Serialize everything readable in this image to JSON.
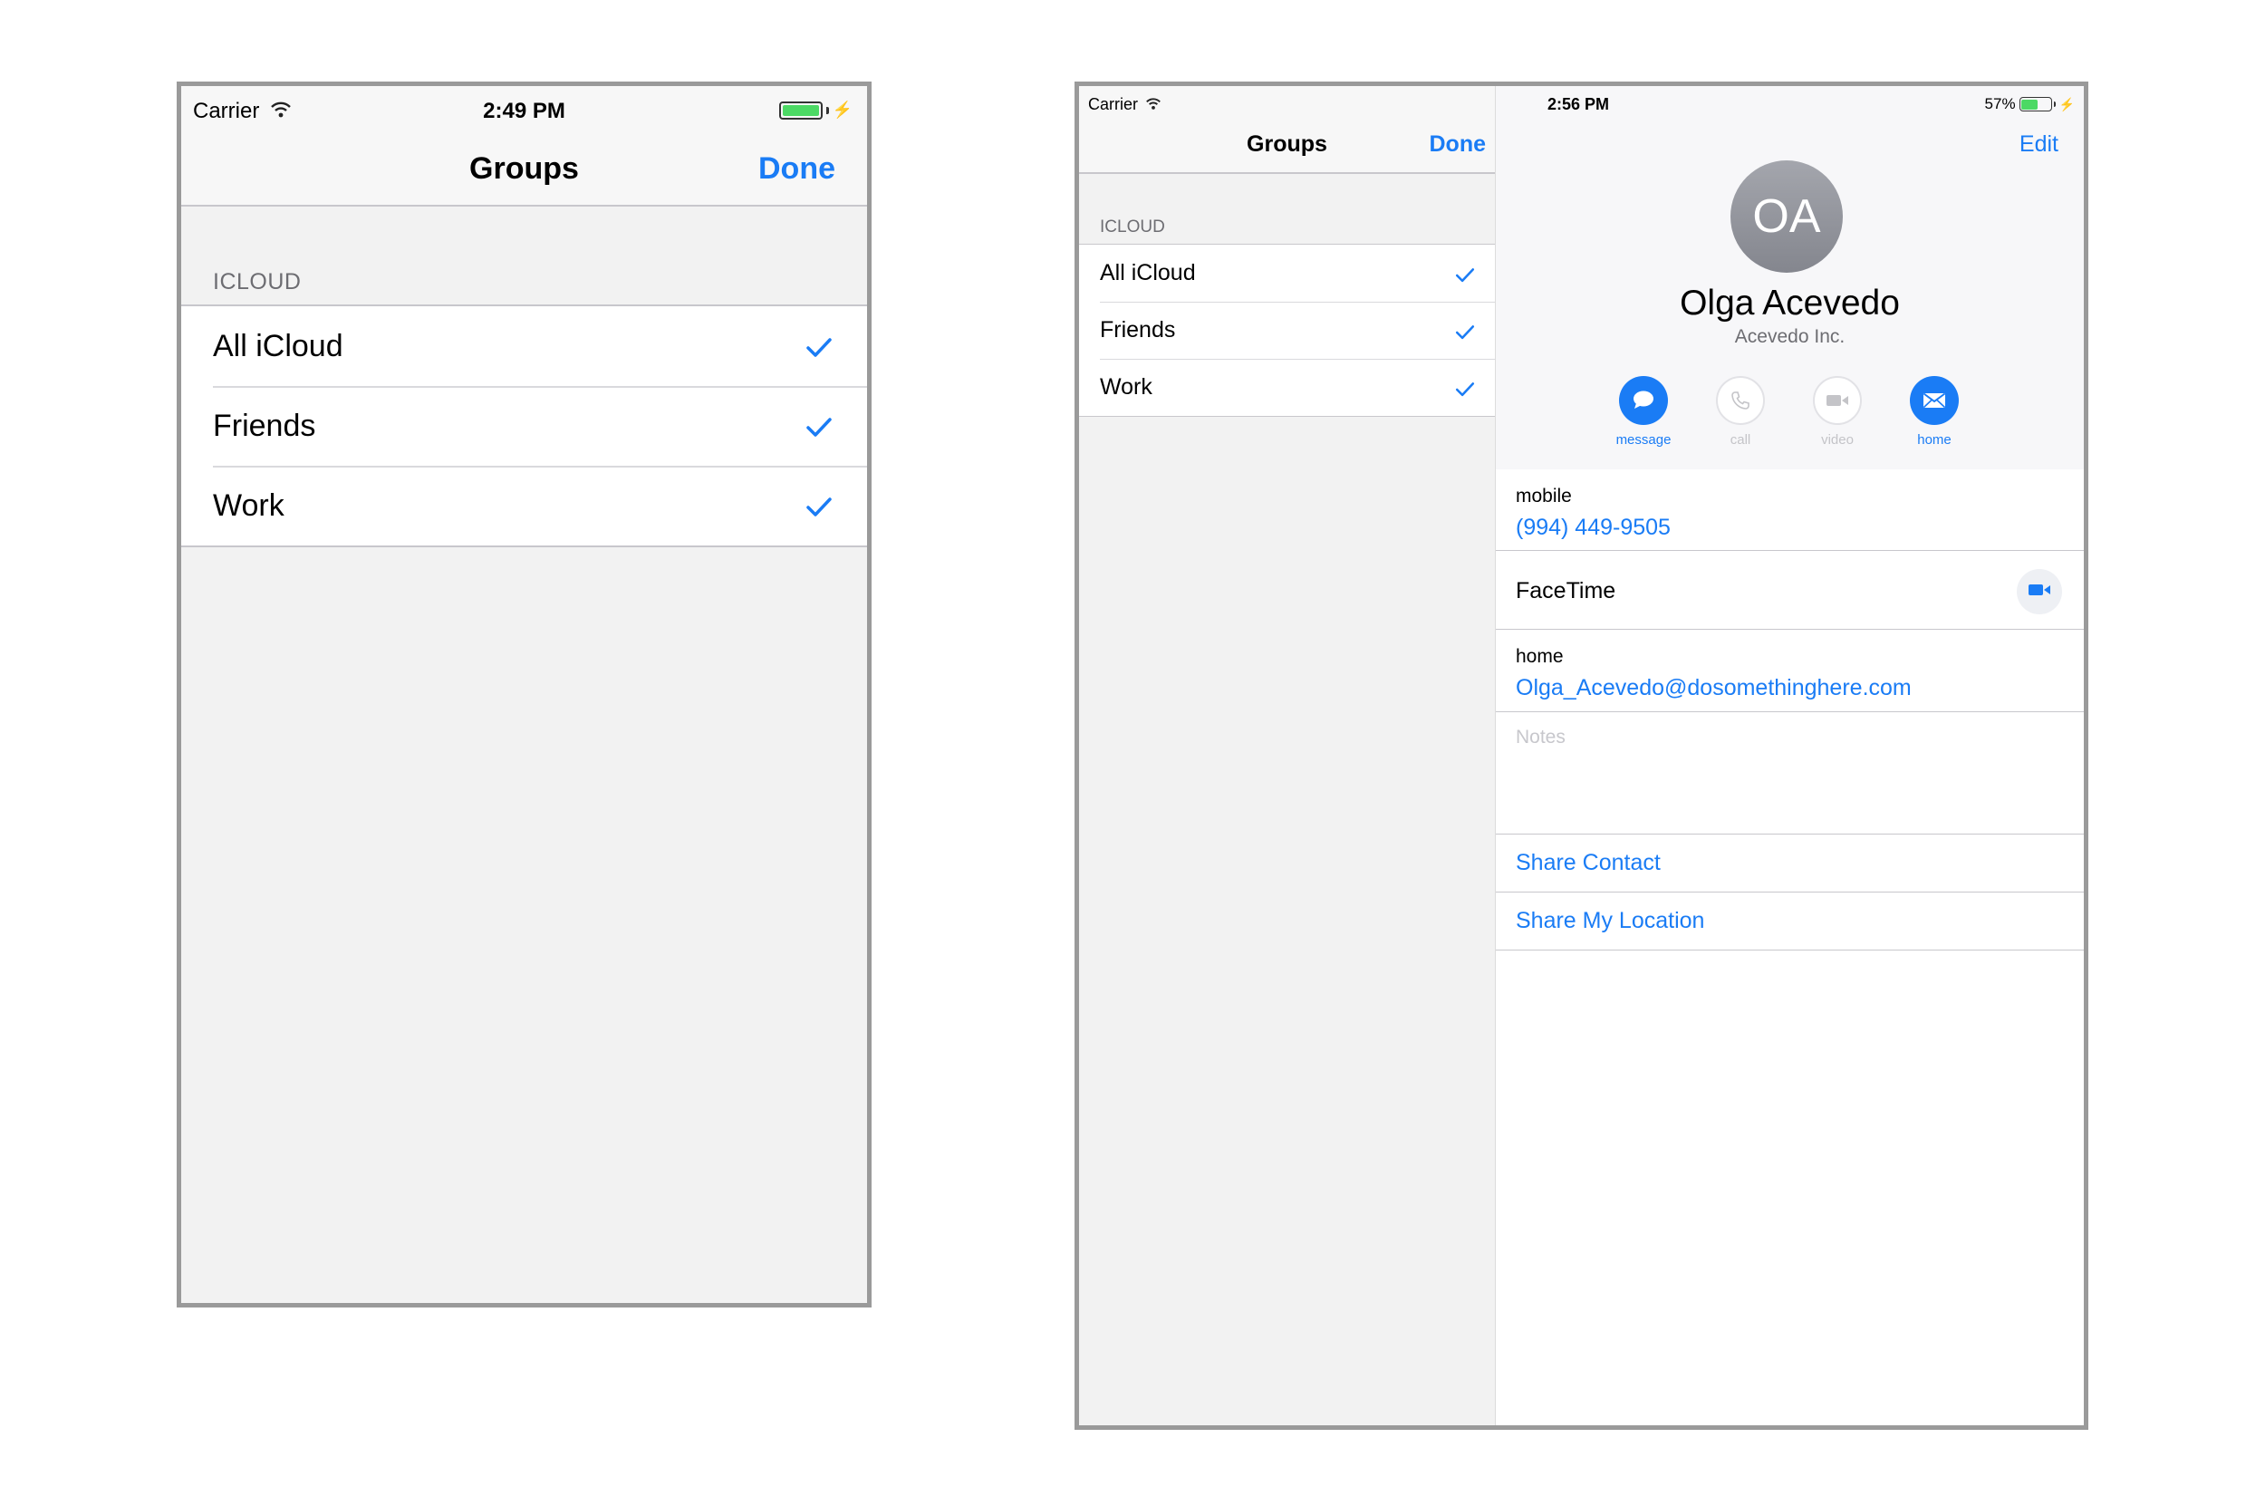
{
  "phone": {
    "status": {
      "carrier": "Carrier",
      "time": "2:49 PM"
    },
    "nav": {
      "title": "Groups",
      "done_label": "Done"
    },
    "section_header": "ICLOUD",
    "groups": [
      {
        "label": "All iCloud",
        "checked": true
      },
      {
        "label": "Friends",
        "checked": true
      },
      {
        "label": "Work",
        "checked": true
      }
    ]
  },
  "tablet": {
    "status": {
      "carrier": "Carrier",
      "time": "2:56 PM",
      "battery": "57%"
    },
    "sidebar": {
      "title": "Groups",
      "done_label": "Done",
      "section_header": "ICLOUD",
      "groups": [
        {
          "label": "All iCloud",
          "checked": true
        },
        {
          "label": "Friends",
          "checked": true
        },
        {
          "label": "Work",
          "checked": true
        }
      ]
    },
    "contact": {
      "edit_label": "Edit",
      "initials": "OA",
      "name": "Olga Acevedo",
      "company": "Acevedo Inc.",
      "actions": [
        {
          "label": "message",
          "icon": "message-icon",
          "enabled": true
        },
        {
          "label": "call",
          "icon": "phone-icon",
          "enabled": false
        },
        {
          "label": "video",
          "icon": "video-camera-icon",
          "enabled": false
        },
        {
          "label": "home",
          "icon": "mail-icon",
          "enabled": true
        }
      ],
      "mobile_label": "mobile",
      "mobile_value": "(994) 449-9505",
      "facetime_label": "FaceTime",
      "home_label": "home",
      "home_value": "Olga_Acevedo@dosomethinghere.com",
      "notes_placeholder": "Notes",
      "share_contact": "Share Contact",
      "share_location": "Share My Location"
    }
  },
  "colors": {
    "accent": "#1a7cf5",
    "battery": "#4cd964",
    "separator": "#c8c7cc",
    "background": "#f2f2f2"
  }
}
